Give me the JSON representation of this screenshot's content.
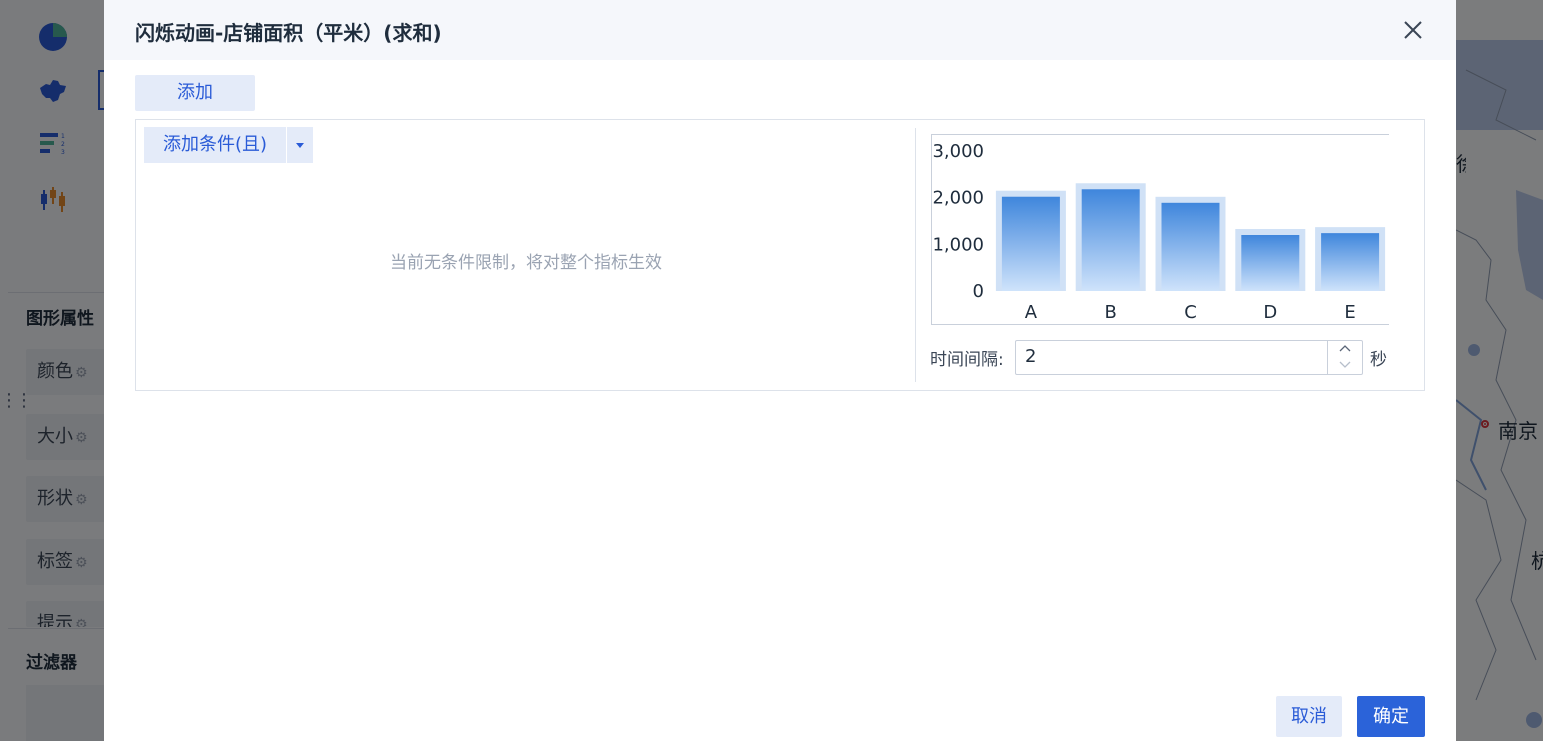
{
  "background": {
    "sidebar": {
      "icons": [
        "pie-chart-icon",
        "china-map-icon",
        "ranked-list-icon",
        "candlestick-icon"
      ],
      "section_title": "图形属性",
      "props": [
        {
          "label": "颜色",
          "icon": "gear-icon"
        },
        {
          "label": "大小",
          "icon": "gear-icon"
        },
        {
          "label": "形状",
          "icon": "gear-icon"
        },
        {
          "label": "标签",
          "icon": "gear-icon"
        },
        {
          "label": "提示",
          "icon": "gear-icon"
        }
      ],
      "filter_title": "过滤器"
    },
    "map": {
      "labels": [
        "南京",
        "杭"
      ],
      "partial_label": "徐"
    }
  },
  "dialog": {
    "title": "闪烁动画-店铺面积（平米）(求和)",
    "add_label": "添加",
    "condition_button": "添加条件(且)",
    "empty_hint": "当前无条件限制，将对整个指标生效",
    "interval_label": "时间间隔:",
    "interval_value": "2",
    "interval_unit": "秒",
    "cancel_label": "取消",
    "confirm_label": "确定"
  },
  "colors": {
    "accent": "#2b63d9",
    "accent_light": "#e4ebf9",
    "bar_top": "#3f86dc",
    "bar_bottom": "#cfe3fb",
    "bar_halo": "#a9c9ef"
  },
  "chart_data": {
    "type": "bar",
    "categories": [
      "A",
      "B",
      "C",
      "D",
      "E"
    ],
    "values": [
      2020,
      2180,
      1890,
      1200,
      1240
    ],
    "yticks": [
      0,
      1000,
      2000,
      3000
    ],
    "ytick_labels": [
      "0",
      "1,000",
      "2,000",
      "3,000"
    ],
    "ylim": [
      0,
      3000
    ],
    "title": "",
    "xlabel": "",
    "ylabel": "",
    "grid": false,
    "legend": false
  }
}
